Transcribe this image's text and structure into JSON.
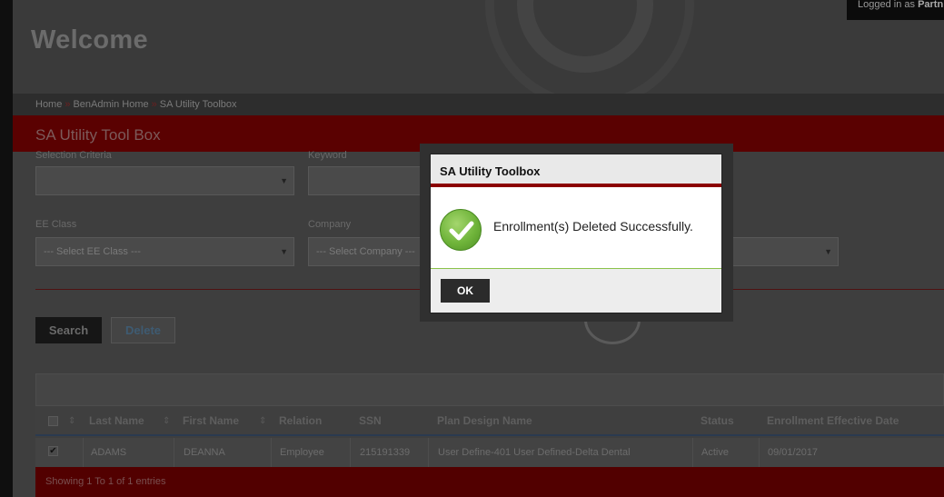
{
  "header": {
    "welcome": "Welcome",
    "logged_in": "Logged in as",
    "logged_in_user": "Partn"
  },
  "breadcrumb": {
    "items": [
      "Home",
      "BenAdmin Home",
      "SA Utility Toolbox"
    ]
  },
  "page_title": "SA Utility Tool Box",
  "form": {
    "selection_criteria_label": "Selection Criteria",
    "selection_criteria_value": "",
    "keyword_label": "Keyword",
    "ee_class_label": "EE Class",
    "ee_class_value": "--- Select EE Class ---",
    "company_label": "Company",
    "company_value": "--- Select Company ---"
  },
  "buttons": {
    "search": "Search",
    "delete": "Delete"
  },
  "table": {
    "columns": [
      "Last Name",
      "First Name",
      "Relation",
      "SSN",
      "Plan Design Name",
      "Status",
      "Enrollment Effective Date"
    ],
    "rows": [
      {
        "checked": true,
        "last_name": "ADAMS",
        "first_name": "DEANNA",
        "relation": "Employee",
        "ssn": "215191339",
        "plan": "User Define-401 User Defined-Delta Dental",
        "status": "Active",
        "effective_date": "09/01/2017"
      }
    ],
    "footer": "Showing 1 To 1 of 1 entries"
  },
  "modal": {
    "title": "SA Utility Toolbox",
    "message": "Enrollment(s) Deleted Successfully.",
    "ok_label": "OK",
    "icon": "success-check-icon"
  },
  "colors": {
    "accent_red": "#8b0000",
    "success_green": "#6fb43a"
  }
}
